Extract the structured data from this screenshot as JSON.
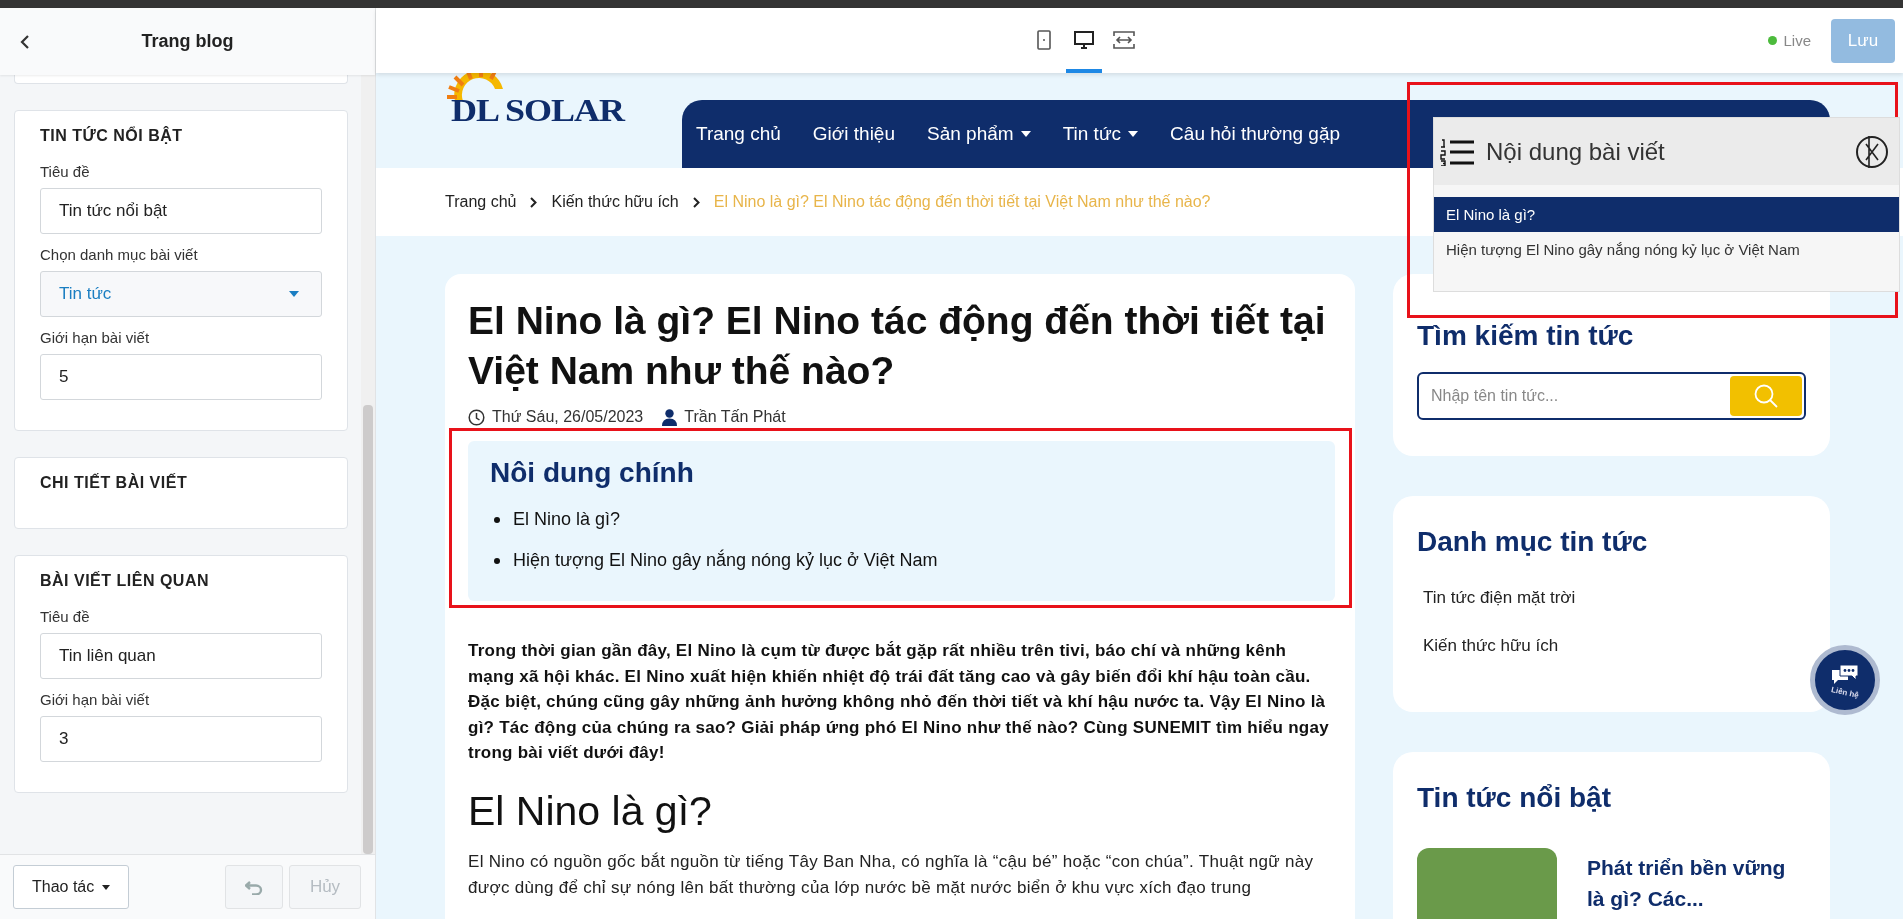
{
  "editor": {
    "title": "Trang blog",
    "panels": [
      {
        "kind": "fields",
        "heading": "TIN TỨC NỔI BẬT",
        "fields": [
          {
            "kind": "text",
            "label": "Tiêu đề",
            "value": "Tin tức nổi bật"
          },
          {
            "kind": "select",
            "label": "Chọn danh mục bài viết",
            "value": "Tin tức"
          },
          {
            "kind": "text",
            "label": "Giới hạn bài viết",
            "value": "5"
          }
        ]
      },
      {
        "kind": "collapsed",
        "heading": "CHI TIẾT BÀI VIẾT"
      },
      {
        "kind": "fields",
        "heading": "BÀI VIẾT LIÊN QUAN",
        "fields": [
          {
            "kind": "text",
            "label": "Tiêu đề",
            "value": "Tin liên quan"
          },
          {
            "kind": "text",
            "label": "Giới hạn bài viết",
            "value": "3"
          }
        ]
      }
    ],
    "footer": {
      "actions": "Thao tác",
      "undo_disabled": true,
      "cancel": {
        "label": "Hủy",
        "disabled": true
      }
    }
  },
  "toolbar": {
    "devices": [
      {
        "kind": "mobile",
        "selected": false
      },
      {
        "kind": "desktop",
        "selected": true
      },
      {
        "kind": "fit",
        "selected": false
      }
    ],
    "status": {
      "label": "Live",
      "color": "#4cbb3c"
    },
    "save": {
      "label": "Lưu",
      "disabled": true
    }
  },
  "site": {
    "logo": "DL SOLAR",
    "nav": [
      {
        "label": "Trang chủ",
        "dropdown": false
      },
      {
        "label": "Giới thiệu",
        "dropdown": false
      },
      {
        "label": "Sản phẩm",
        "dropdown": true
      },
      {
        "label": "Tin tức",
        "dropdown": true
      },
      {
        "label": "Câu hỏi thường gặp",
        "dropdown": false
      }
    ],
    "breadcrumb": [
      {
        "label": "Trang chủ",
        "current": false
      },
      {
        "label": "Kiến thức hữu ích",
        "current": false
      },
      {
        "label": "El Nino là gì? El Nino tác động đến thời tiết tại Việt Nam như thế nào?",
        "current": true
      }
    ],
    "article": {
      "title": "El Nino là gì? El Nino tác động đến thời tiết tại Việt Nam như thế nào?",
      "date": "Thứ Sáu, 26/05/2023",
      "author": "Trần Tấn Phát",
      "toc": {
        "heading": "Nôi dung chính",
        "items": [
          "El Nino là gì?",
          "Hiện tượng El Nino gây nắng nóng kỷ lục ở Việt Nam"
        ]
      },
      "intro": "Trong thời gian gần đây, El Nino là cụm từ được bắt gặp rất nhiều trên tivi, báo chí và những kênh mạng xã hội khác. El Nino xuất hiện khiến nhiệt độ trái đất tăng cao và gây biến đổi khí hậu toàn cầu. Đặc biệt, chúng cũng gây những ảnh hưởng không nhỏ đến thời tiết và khí hậu nước ta. Vậy El Nino là gì? Tác động của chúng ra sao? Giải pháp ứng phó El Nino như thế nào? Cùng SUNEMIT tìm hiểu ngay trong bài viết dưới đây!",
      "section_heading": "El Nino là gì?",
      "body": "El Nino có nguồn gốc bắt nguồn từ tiếng Tây Ban Nha, có nghĩa là “cậu bé” hoặc “con chúa”. Thuật ngữ này được dùng để chỉ sự nóng lên bất thường của lớp nước bề mặt nước biển ở khu vực xích đạo trung"
    },
    "toc_popup": {
      "title": "Nội dung bài viết",
      "items": [
        {
          "label": "El Nino là gì?",
          "selected": true
        },
        {
          "label": "Hiện tượng El Nino gây nắng nóng kỷ lục ở Việt Nam",
          "selected": false
        }
      ]
    },
    "sidebar": {
      "search": {
        "heading": "Tìm kiếm tin tức",
        "placeholder": "Nhập tên tin tức..."
      },
      "categories": {
        "heading": "Danh mục tin tức",
        "items": [
          "Tin tức điện mặt trời",
          "Kiến thức hữu ích"
        ]
      },
      "featured": {
        "heading": "Tin tức nổi bật",
        "posts": [
          {
            "title": "Phát triển bền vững là gì? Các..."
          }
        ]
      }
    },
    "chat_button": "Liên hệ"
  }
}
